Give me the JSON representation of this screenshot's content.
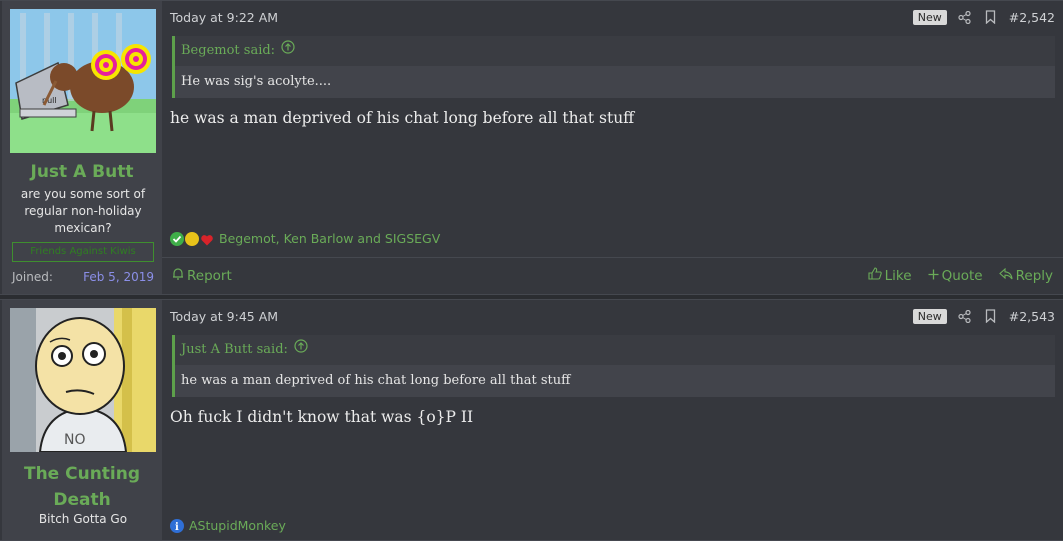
{
  "posts": [
    {
      "user": {
        "name": "Just A Butt",
        "title": "are you some sort of regular non-holiday mexican?",
        "banner": "Friends Against Kiwis",
        "joined_label": "Joined:",
        "joined_value": "Feb 5, 2019"
      },
      "time": "Today at 9:22 AM",
      "badge": "New",
      "number": "#2,542",
      "quote": {
        "author": "Begemot said:",
        "text": "He was sig's acolyte...."
      },
      "message": "he was a man deprived of his chat long before all that stuff",
      "reactions": "Begemot, Ken Barlow and SIGSEGV",
      "actions": {
        "report": "Report",
        "like": "Like",
        "quote": "Quote",
        "reply": "Reply"
      }
    },
    {
      "user": {
        "name": "The Cunting Death",
        "title": "Bitch Gotta Go"
      },
      "time": "Today at 9:45 AM",
      "badge": "New",
      "number": "#2,543",
      "quote": {
        "author": "Just A Butt said:",
        "text": "he was a man deprived of his chat long before all that stuff"
      },
      "message": "Oh fuck I didn't know that was {o}P II",
      "reactions": "AStupidMonkey"
    }
  ],
  "colors": {
    "accent": "#6aab58",
    "background": "#35373d",
    "user_col": "#404249"
  }
}
